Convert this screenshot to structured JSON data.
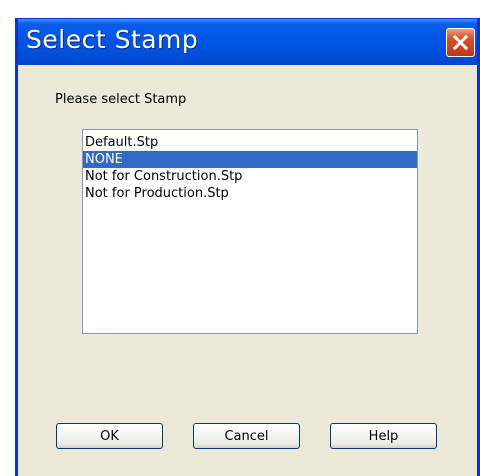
{
  "dialog": {
    "title": "Select Stamp",
    "prompt": "Please select Stamp"
  },
  "stamps": {
    "items": [
      "Default.Stp",
      "NONE",
      "Not for Construction.Stp",
      "Not for Production.Stp"
    ],
    "selected": "NONE"
  },
  "buttons": {
    "ok": "OK",
    "cancel": "Cancel",
    "help": "Help"
  },
  "colors": {
    "titlebar": "#0055e5",
    "selection": "#316ac5",
    "dialog_background": "#ece9d8",
    "close_button": "#d8502c"
  },
  "icons": {
    "close": "close-icon"
  }
}
